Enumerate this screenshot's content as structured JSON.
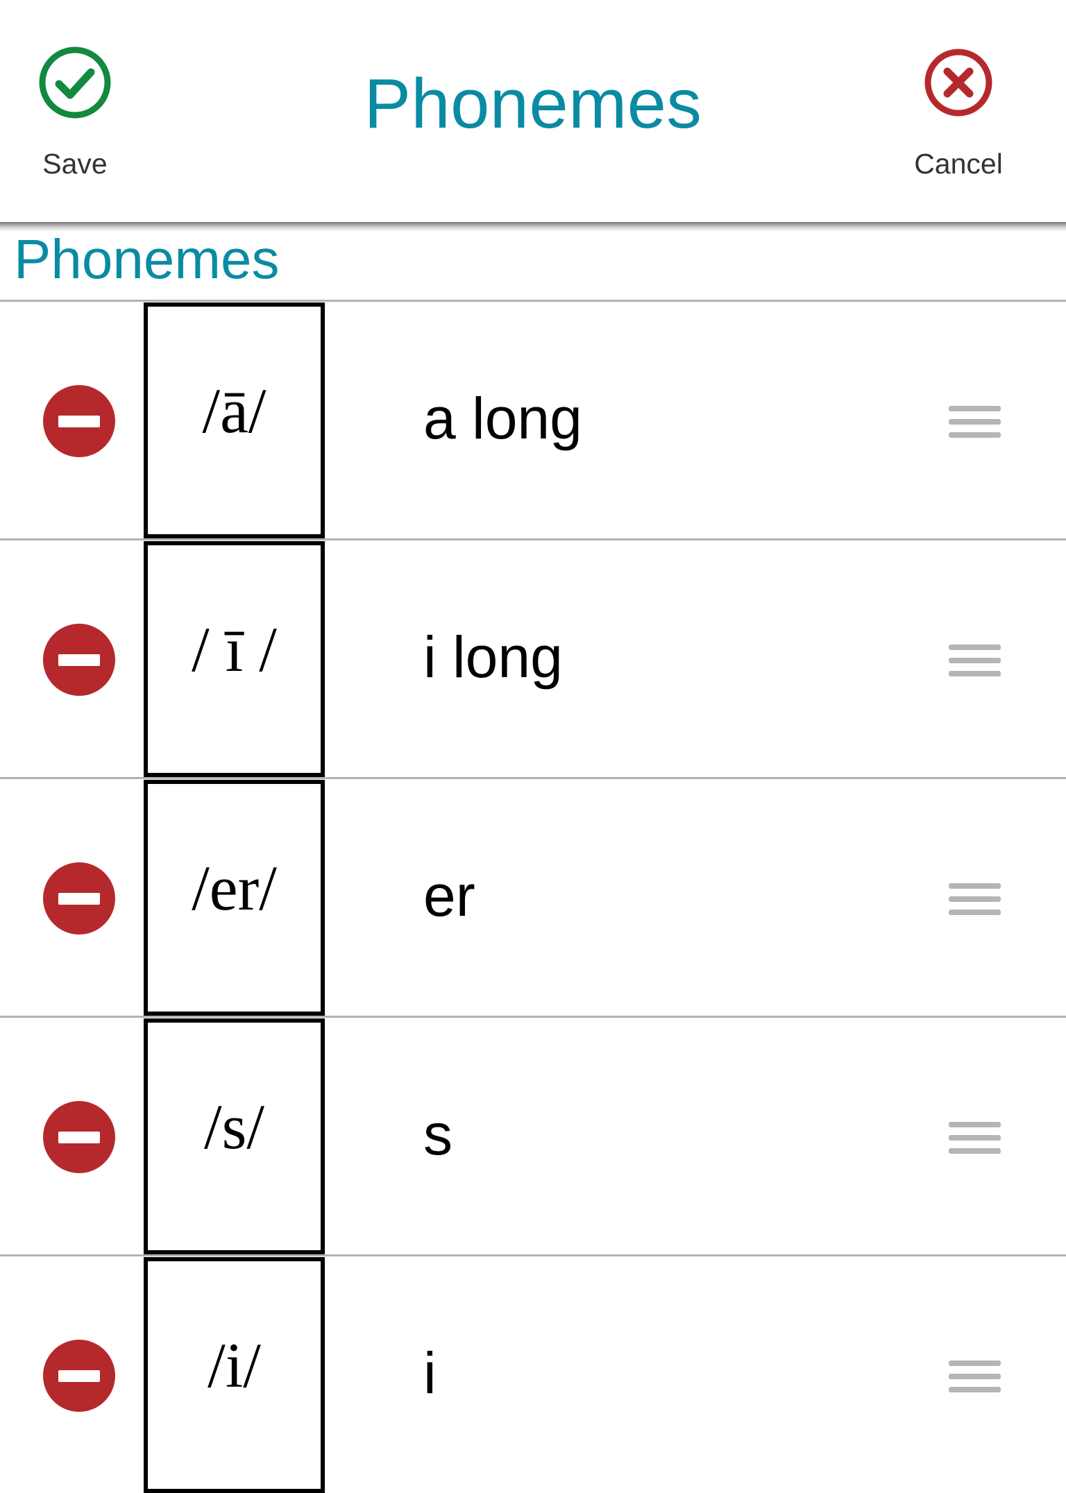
{
  "header": {
    "title": "Phonemes",
    "save_label": "Save",
    "save_icon": "check-circle-icon",
    "cancel_label": "Cancel",
    "cancel_icon": "x-circle-icon"
  },
  "section": {
    "title": "Phonemes"
  },
  "rows": [
    {
      "phoneme": "/ā/",
      "name": "a long"
    },
    {
      "phoneme": "/ ī /",
      "name": "i long"
    },
    {
      "phoneme": "/er/",
      "name": "er"
    },
    {
      "phoneme": "/s/",
      "name": "s"
    },
    {
      "phoneme": "/i/",
      "name": "i"
    }
  ],
  "icons": {
    "delete": "minus-circle-icon",
    "reorder": "drag-handle-icon"
  },
  "colors": {
    "accent_teal": "#0a8ba4",
    "save_green": "#12893f",
    "cancel_red": "#b5292c",
    "delete_red": "#b5292c",
    "handle_gray": "#b5b5b5",
    "divider_gray": "#b3b3b3"
  }
}
